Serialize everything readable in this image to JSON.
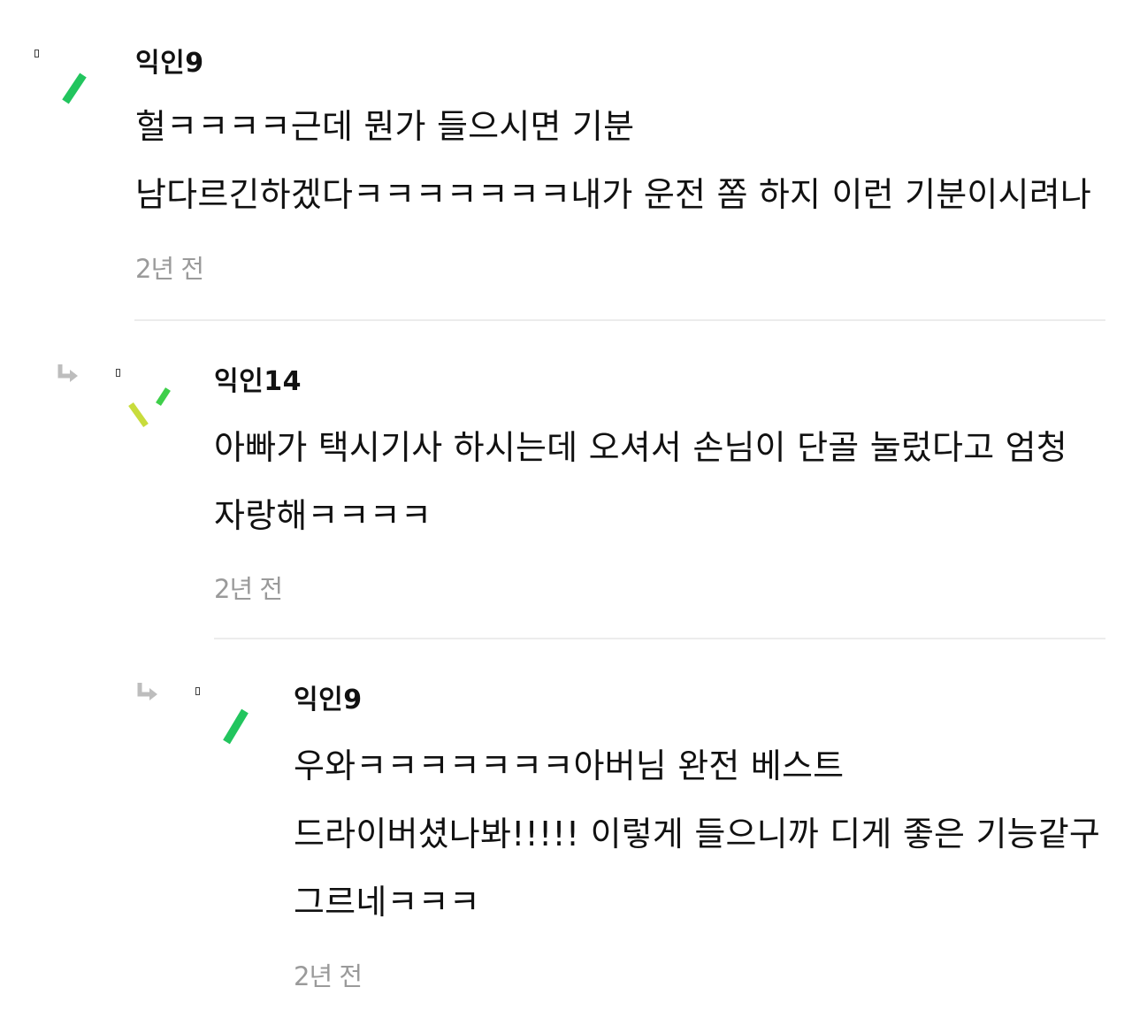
{
  "comments": [
    {
      "author": "익인9",
      "text": "헐ㅋㅋㅋㅋ근데 뭔가 들으시면 기분 남다르긴하겠다ㅋㅋㅋㅋㅋㅋㅋ내가 운전 쫌 하지 이런 기분이시려나",
      "time": "2년 전",
      "is_reply": false,
      "avatar_colors": [
        "#22c55e"
      ]
    },
    {
      "author": "익인14",
      "text": "아빠가 택시기사 하시는데 오셔서 손님이 단골 눌렀다고 엄청 자랑해ㅋㅋㅋㅋ",
      "time": "2년 전",
      "is_reply": true,
      "avatar_colors": [
        "#c8dc3c",
        "#3ecf4a"
      ]
    },
    {
      "author": "익인9",
      "text": "우와ㅋㅋㅋㅋㅋㅋㅋ아버님 완전 베스트 드라이버셨나봐!!!!! 이렇게 들으니까 디게 좋은 기능같구 그르네ㅋㅋㅋ",
      "time": "2년 전",
      "is_reply": true,
      "avatar_colors": [
        "#22c55e"
      ]
    }
  ]
}
